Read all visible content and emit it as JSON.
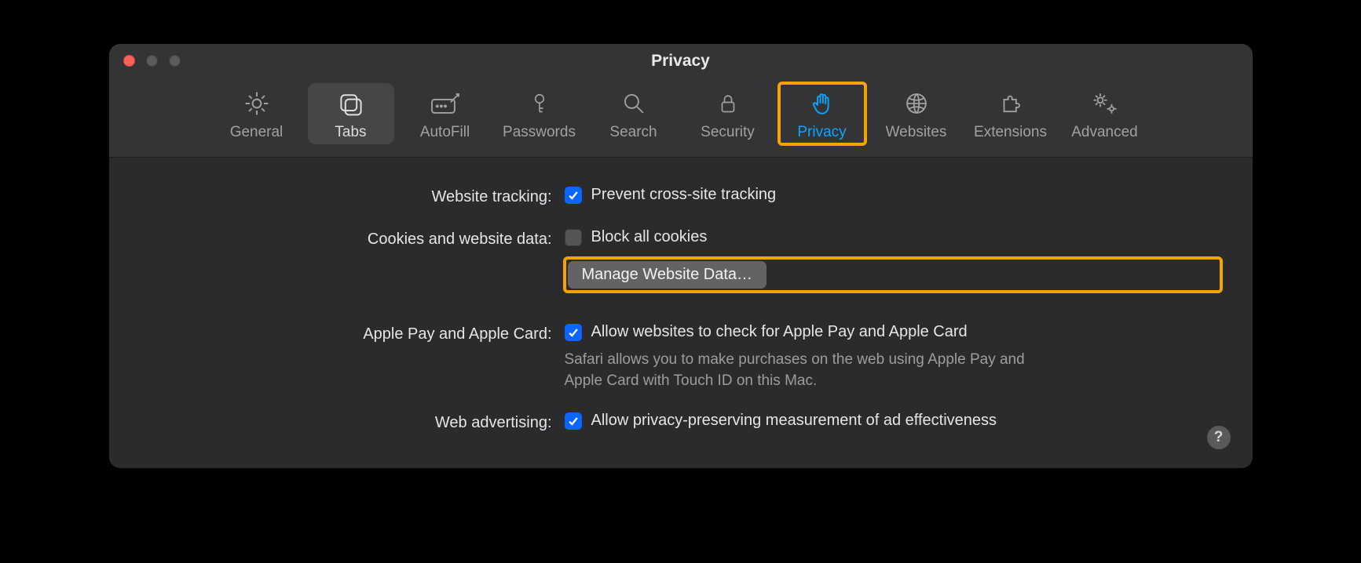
{
  "window": {
    "title": "Privacy"
  },
  "tabs": [
    {
      "id": "general",
      "label": "General"
    },
    {
      "id": "tabs",
      "label": "Tabs"
    },
    {
      "id": "autofill",
      "label": "AutoFill"
    },
    {
      "id": "passwords",
      "label": "Passwords"
    },
    {
      "id": "search",
      "label": "Search"
    },
    {
      "id": "security",
      "label": "Security"
    },
    {
      "id": "privacy",
      "label": "Privacy"
    },
    {
      "id": "websites",
      "label": "Websites"
    },
    {
      "id": "extensions",
      "label": "Extensions"
    },
    {
      "id": "advanced",
      "label": "Advanced"
    }
  ],
  "sections": {
    "tracking": {
      "label": "Website tracking:",
      "checkbox_label": "Prevent cross-site tracking",
      "checked": true
    },
    "cookies": {
      "label": "Cookies and website data:",
      "checkbox_label": "Block all cookies",
      "checked": false,
      "button_label": "Manage Website Data…"
    },
    "applepay": {
      "label": "Apple Pay and Apple Card:",
      "checkbox_label": "Allow websites to check for Apple Pay and Apple Card",
      "checked": true,
      "description": "Safari allows you to make purchases on the web using Apple Pay and Apple Card with Touch ID on this Mac."
    },
    "ads": {
      "label": "Web advertising:",
      "checkbox_label": "Allow privacy-preserving measurement of ad effectiveness",
      "checked": true
    }
  },
  "help_label": "?"
}
